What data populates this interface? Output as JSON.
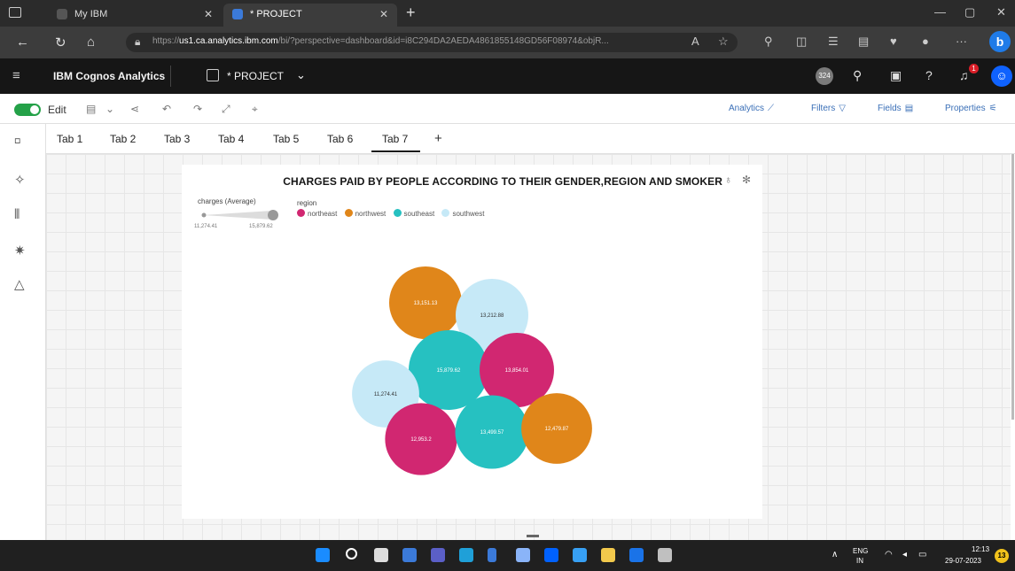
{
  "browser": {
    "tabs": [
      {
        "label": "My IBM",
        "active": false
      },
      {
        "label": "* PROJECT",
        "active": true
      }
    ],
    "url_prefix": "https://",
    "url_host": "us1.ca.analytics.ibm.com",
    "url_rest": "/bi/?perspective=dashboard&id=i8C294DA2AEDA4861855148GD56F08974&objR...",
    "win_min": "—",
    "win_max": "▢",
    "win_close": "✕"
  },
  "app": {
    "brand": "IBM Cognos Analytics",
    "project": "* PROJECT",
    "notif_count": "324",
    "alert_count": "1"
  },
  "toolbar": {
    "edit_label": "Edit",
    "analytics_label": "Analytics",
    "filters_label": "Filters",
    "fields_label": "Fields",
    "properties_label": "Properties"
  },
  "tabs": [
    "Tab 1",
    "Tab 2",
    "Tab 3",
    "Tab 4",
    "Tab 5",
    "Tab 6",
    "Tab 7"
  ],
  "active_tab": "Tab 7",
  "visualization": {
    "title": "CHARGES PAID BY PEOPLE ACCORDING TO THEIR GENDER,REGION AND SMOKER",
    "size_legend_title": "charges (Average)",
    "size_min_label": "11,274.41",
    "size_max_label": "15,879.62",
    "color_legend_title": "region"
  },
  "chart_data": {
    "type": "bubble",
    "size_measure": "charges (Average)",
    "color_by": "region",
    "regions": [
      {
        "name": "northeast",
        "color": "#d12771"
      },
      {
        "name": "northwest",
        "color": "#e0861a"
      },
      {
        "name": "southeast",
        "color": "#26c1c1"
      },
      {
        "name": "southwest",
        "color": "#c6e9f7"
      }
    ],
    "bubbles": [
      {
        "label": "13,151.13",
        "value": 13151.13,
        "region": "northwest"
      },
      {
        "label": "13,212.88",
        "value": 13212.88,
        "region": "southwest"
      },
      {
        "label": "15,879.62",
        "value": 15879.62,
        "region": "southeast"
      },
      {
        "label": "13,854.01",
        "value": 13854.01,
        "region": "northeast"
      },
      {
        "label": "11,274.41",
        "value": 11274.41,
        "region": "southwest"
      },
      {
        "label": "12,953.2",
        "value": 12953.2,
        "region": "northeast"
      },
      {
        "label": "13,499.57",
        "value": 13499.57,
        "region": "southeast"
      },
      {
        "label": "12,479.87",
        "value": 12479.87,
        "region": "northwest"
      }
    ]
  },
  "taskbar": {
    "lang": "ENG",
    "lang_sub": "IN",
    "time": "12:13",
    "date": "29-07-2023",
    "badge": "13"
  }
}
